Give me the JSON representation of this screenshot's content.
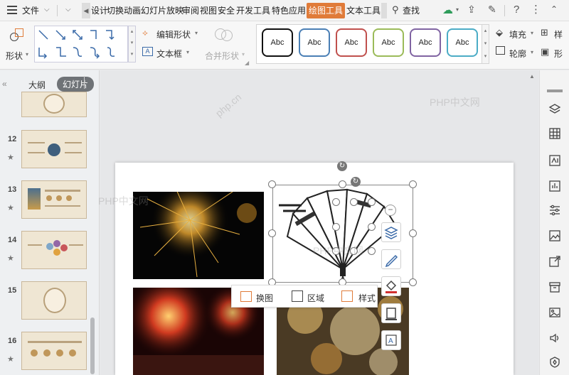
{
  "menubar": {
    "file_label": "文件",
    "tabs": [
      {
        "label": "设计"
      },
      {
        "label": "切换"
      },
      {
        "label": "动画"
      },
      {
        "label": "幻灯片放映"
      },
      {
        "label": "审阅"
      },
      {
        "label": "视图"
      },
      {
        "label": "安全"
      },
      {
        "label": "开发工具"
      },
      {
        "label": "特色应用"
      },
      {
        "label": "绘图工具"
      },
      {
        "label": "文本工具"
      }
    ],
    "search_label": "查找"
  },
  "ribbon": {
    "shape_label": "形状",
    "edit_shape_label": "编辑形状",
    "textbox_label": "文本框",
    "merge_shape_label": "合并形状",
    "style_sample": "Abc",
    "style_colors": [
      "#111111",
      "#4a7fb5",
      "#c0504d",
      "#9bbb59",
      "#8064a2",
      "#4bacc6"
    ],
    "fill_label": "填充",
    "outline_label": "轮廓",
    "right_cut_1": "样",
    "right_cut_2": "形"
  },
  "leftpanel": {
    "tab_outline": "大纲",
    "tab_slides": "幻灯片",
    "slides": [
      {
        "num": "12"
      },
      {
        "num": "13"
      },
      {
        "num": "14"
      },
      {
        "num": "15"
      },
      {
        "num": "16"
      }
    ]
  },
  "context_bar": {
    "replace_label": "换图",
    "region_label": "区域",
    "style_label": "样式"
  },
  "watermarks": {
    "w1": "PHP中文网",
    "w2": "PHP中文网",
    "w3": "PHP中文网",
    "w4": "php.cn"
  }
}
